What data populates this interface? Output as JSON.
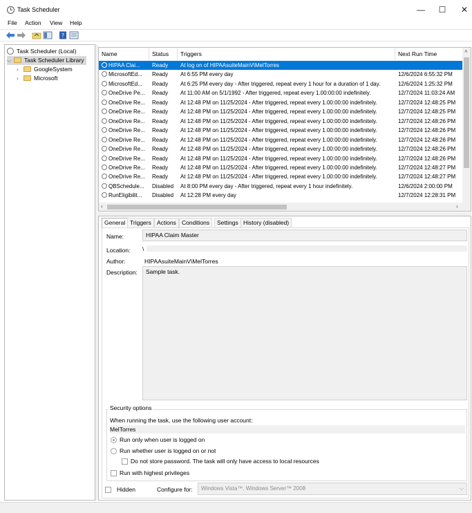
{
  "window": {
    "title": "Task Scheduler",
    "minimize": "—",
    "maximize": "☐",
    "close": "✕"
  },
  "menu": [
    "File",
    "Action",
    "View",
    "Help"
  ],
  "toolbar": {
    "icons": [
      "back-arrow-icon",
      "forward-arrow-icon",
      "folder-up-icon",
      "show-hide-pane-icon",
      "help-icon",
      "properties-icon"
    ]
  },
  "tree": {
    "root": "Task Scheduler (Local)",
    "library": "Task Scheduler Library",
    "children": [
      "GoogleSystem",
      "Microsoft"
    ]
  },
  "tasklist": {
    "columns": [
      "Name",
      "Status",
      "Triggers",
      "Next Run Time"
    ],
    "rows": [
      {
        "name": "HIPAA Clai...",
        "status": "Ready",
        "trigger": "At log on of HIPAAsuiteMainV\\MelTorres",
        "next": ""
      },
      {
        "name": "MicrosoftEd...",
        "status": "Ready",
        "trigger": "At 6:55 PM every day",
        "next": "12/6/2024 6:55:32 PM"
      },
      {
        "name": "MicrosoftEd...",
        "status": "Ready",
        "trigger": "At 6:25 PM every day - After triggered, repeat every 1 hour for a duration of 1 day.",
        "next": "12/6/2024 1:25:32 PM"
      },
      {
        "name": "OneDrive Pe...",
        "status": "Ready",
        "trigger": "At 11:00 AM on 5/1/1992 - After triggered, repeat every 1.00:00:00 indefinitely.",
        "next": "12/7/2024 11:03:24 AM"
      },
      {
        "name": "OneDrive Re...",
        "status": "Ready",
        "trigger": "At 12:48 PM on 11/25/2024 - After triggered, repeat every 1.00:00:00 indefinitely.",
        "next": "12/7/2024 12:48:25 PM"
      },
      {
        "name": "OneDrive Re...",
        "status": "Ready",
        "trigger": "At 12:48 PM on 11/25/2024 - After triggered, repeat every 1.00:00:00 indefinitely.",
        "next": "12/7/2024 12:48:25 PM"
      },
      {
        "name": "OneDrive Re...",
        "status": "Ready",
        "trigger": "At 12:48 PM on 11/25/2024 - After triggered, repeat every 1.00:00:00 indefinitely.",
        "next": "12/7/2024 12:48:26 PM"
      },
      {
        "name": "OneDrive Re...",
        "status": "Ready",
        "trigger": "At 12:48 PM on 11/25/2024 - After triggered, repeat every 1.00:00:00 indefinitely.",
        "next": "12/7/2024 12:48:26 PM"
      },
      {
        "name": "OneDrive Re...",
        "status": "Ready",
        "trigger": "At 12:48 PM on 11/25/2024 - After triggered, repeat every 1.00:00:00 indefinitely.",
        "next": "12/7/2024 12:48:26 PM"
      },
      {
        "name": "OneDrive Re...",
        "status": "Ready",
        "trigger": "At 12:48 PM on 11/25/2024 - After triggered, repeat every 1.00:00:00 indefinitely.",
        "next": "12/7/2024 12:48:26 PM"
      },
      {
        "name": "OneDrive Re...",
        "status": "Ready",
        "trigger": "At 12:48 PM on 11/25/2024 - After triggered, repeat every 1.00:00:00 indefinitely.",
        "next": "12/7/2024 12:48:26 PM"
      },
      {
        "name": "OneDrive Re...",
        "status": "Ready",
        "trigger": "At 12:48 PM on 11/25/2024 - After triggered, repeat every 1.00:00:00 indefinitely.",
        "next": "12/7/2024 12:48:27 PM"
      },
      {
        "name": "OneDrive Re...",
        "status": "Ready",
        "trigger": "At 12:48 PM on 11/25/2024 - After triggered, repeat every 1.00:00:00 indefinitely.",
        "next": "12/7/2024 12:48:27 PM"
      },
      {
        "name": "QBSchedule...",
        "status": "Disabled",
        "trigger": "At 8:00 PM every day - After triggered, repeat every 1 hour indefinitely.",
        "next": "12/6/2024 2:00:00 PM"
      },
      {
        "name": "RunEligibilit...",
        "status": "Disabled",
        "trigger": "At 12:28 PM every day",
        "next": "12/7/2024 12:28:31 PM"
      }
    ]
  },
  "detail": {
    "tabs": [
      "General",
      "Triggers",
      "Actions",
      "Conditions",
      "Settings",
      "History (disabled)"
    ],
    "name_label": "Name:",
    "name_value": "HIPAA Claim Master",
    "location_label": "Location:",
    "location_value": "\\",
    "author_label": "Author:",
    "author_value": "HIPAAsuiteMainV\\MelTorres",
    "description_label": "Description:",
    "description_value": "Sample task.",
    "security_title": "Security options",
    "security_prompt": "When running the task, use the following user account:",
    "user_account": "MelTorres",
    "radio_logged_on": "Run only when user is logged on",
    "radio_whether": "Run whether user is logged on or not",
    "no_store_password": "Do not store password.  The task will only have access to local resources",
    "highest_privileges": "Run with highest privileges",
    "hidden": "Hidden",
    "configure_label": "Configure for:",
    "configure_value": "Windows Vista™, Windows Server™ 2008"
  }
}
